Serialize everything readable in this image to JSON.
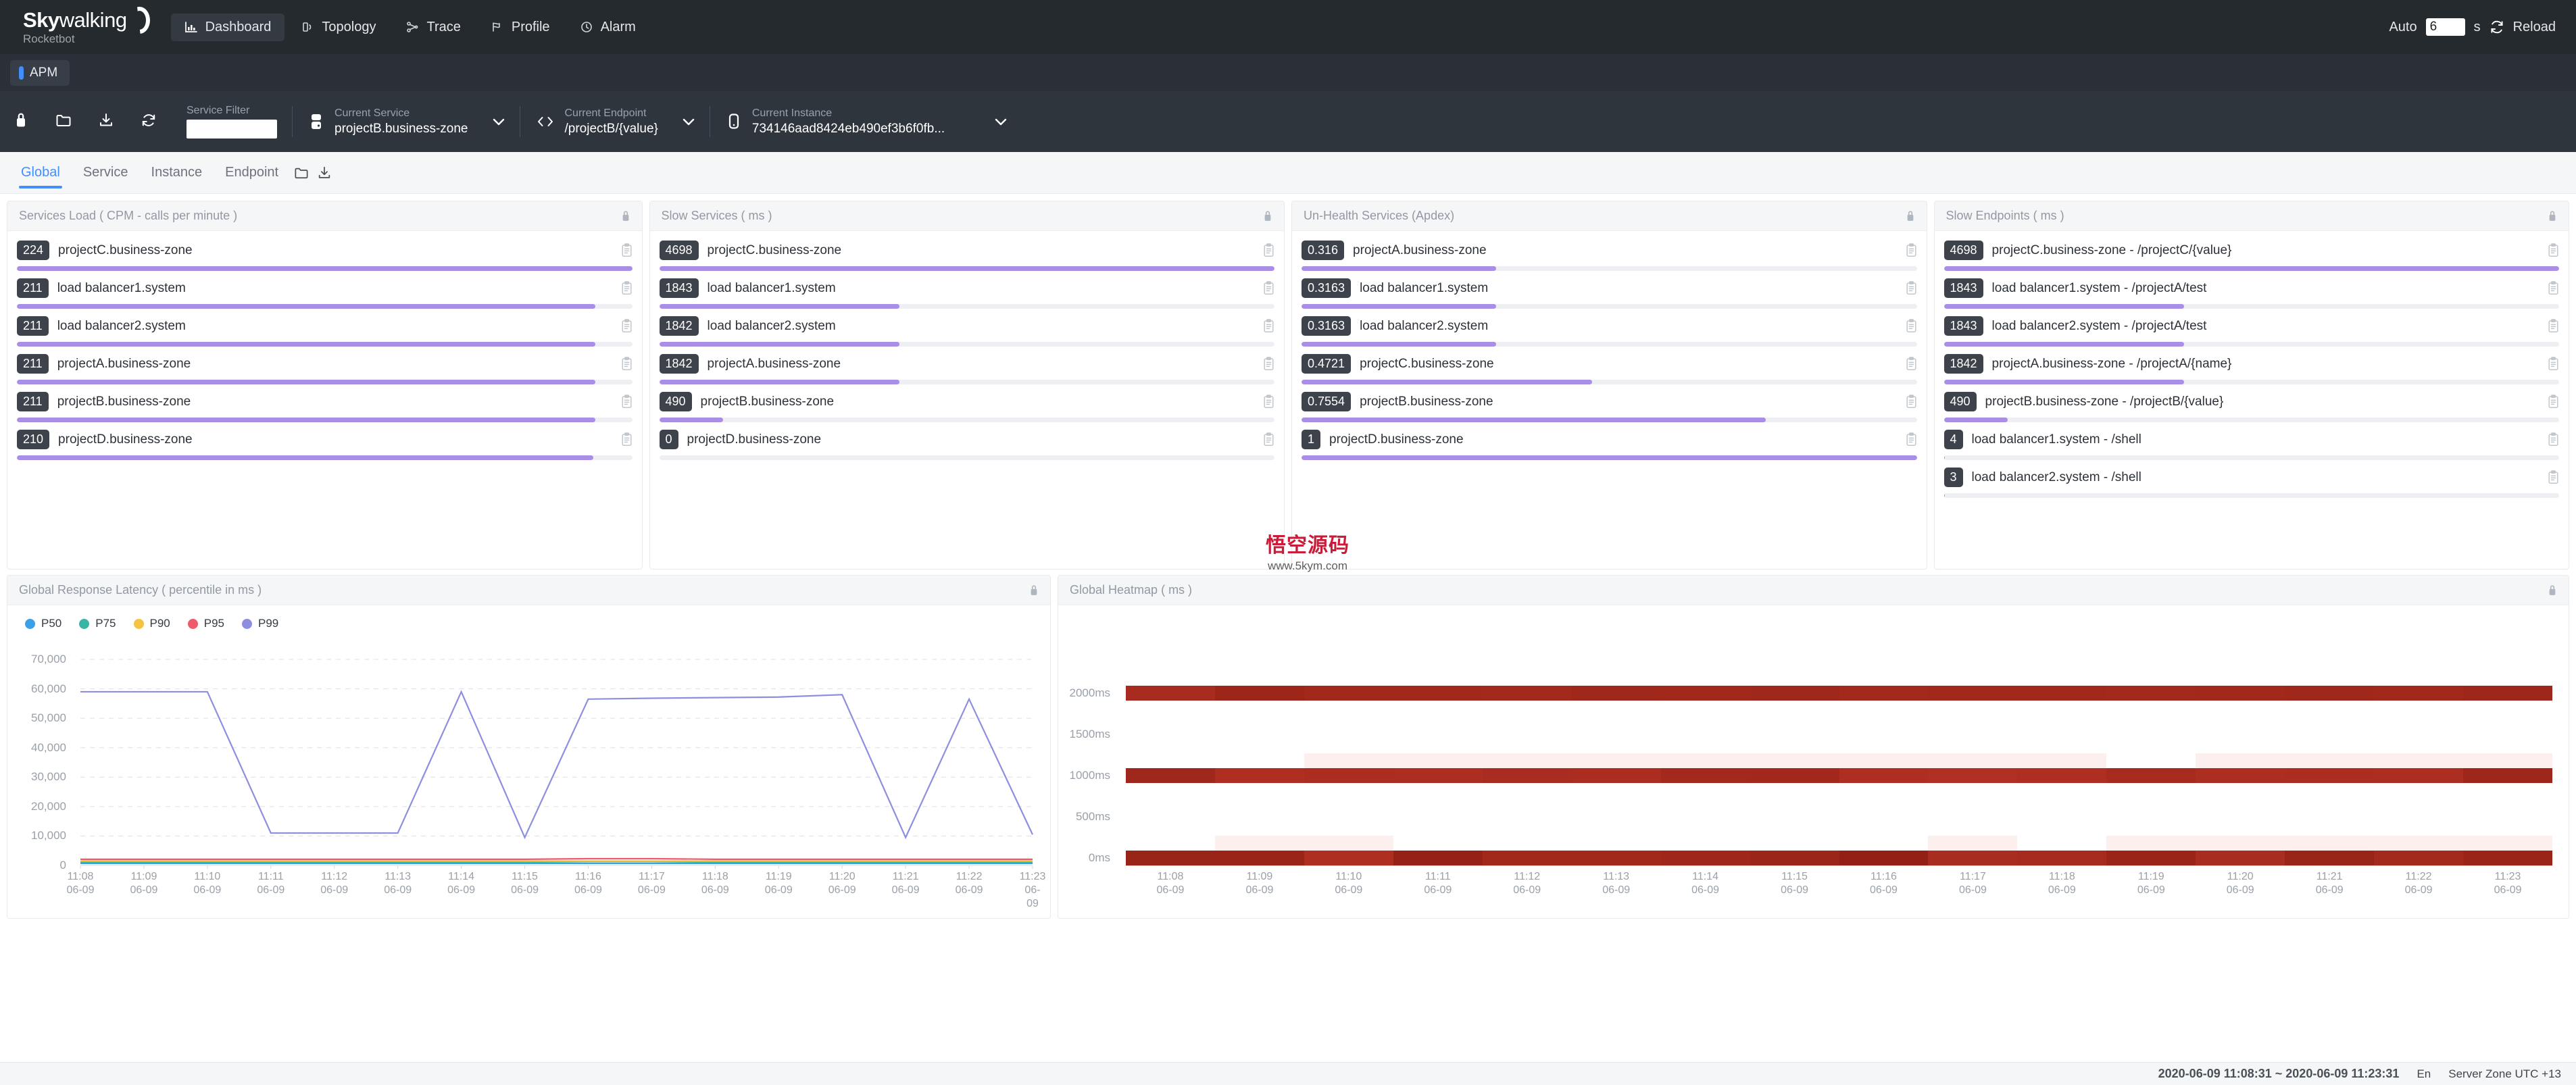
{
  "header": {
    "brand_primary": "Sky",
    "brand_secondary": "walking",
    "brand_sub": "Rocketbot",
    "nav": [
      {
        "label": "Dashboard",
        "icon": "chart-bar-icon",
        "active": true
      },
      {
        "label": "Topology",
        "icon": "topology-icon",
        "active": false
      },
      {
        "label": "Trace",
        "icon": "trace-icon",
        "active": false
      },
      {
        "label": "Profile",
        "icon": "profile-icon",
        "active": false
      },
      {
        "label": "Alarm",
        "icon": "alarm-icon",
        "active": false
      }
    ],
    "auto_label": "Auto",
    "auto_value": "6",
    "auto_unit": "s",
    "reload_label": "Reload",
    "reload_icon": "reload-icon"
  },
  "apm_bar": {
    "tab_label": "APM",
    "accent": "#448dfe"
  },
  "toolbar": {
    "icons": [
      "lock-icon",
      "folder-icon",
      "download-icon",
      "refresh-icon"
    ],
    "service_filter": {
      "label": "Service Filter",
      "value": "",
      "placeholder": ""
    },
    "current_service": {
      "label": "Current Service",
      "value": "projectB.business-zone",
      "icon": "server-icon"
    },
    "current_endpoint": {
      "label": "Current Endpoint",
      "value": "/projectB/{value}",
      "icon": "code-icon"
    },
    "current_instance": {
      "label": "Current Instance",
      "value": "734146aad8424eb490ef3b6f0fb...",
      "icon": "instance-icon"
    }
  },
  "subtabs": {
    "items": [
      {
        "label": "Global",
        "active": true
      },
      {
        "label": "Service",
        "active": false
      },
      {
        "label": "Instance",
        "active": false
      },
      {
        "label": "Endpoint",
        "active": false
      }
    ],
    "actions": [
      "folder-icon",
      "download-icon"
    ]
  },
  "cards": [
    {
      "title": "Services Load ( CPM - calls per minute )",
      "lock_icon": "lock-icon",
      "rows": [
        {
          "value": "224",
          "label": "projectC.business-zone",
          "pct": 100
        },
        {
          "value": "211",
          "label": "load balancer1.system",
          "pct": 94
        },
        {
          "value": "211",
          "label": "load balancer2.system",
          "pct": 94
        },
        {
          "value": "211",
          "label": "projectA.business-zone",
          "pct": 94
        },
        {
          "value": "211",
          "label": "projectB.business-zone",
          "pct": 94
        },
        {
          "value": "210",
          "label": "projectD.business-zone",
          "pct": 93.7
        }
      ]
    },
    {
      "title": "Slow Services ( ms )",
      "lock_icon": "lock-icon",
      "rows": [
        {
          "value": "4698",
          "label": "projectC.business-zone",
          "pct": 100
        },
        {
          "value": "1843",
          "label": "load balancer1.system",
          "pct": 39
        },
        {
          "value": "1842",
          "label": "load balancer2.system",
          "pct": 39
        },
        {
          "value": "1842",
          "label": "projectA.business-zone",
          "pct": 39
        },
        {
          "value": "490",
          "label": "projectB.business-zone",
          "pct": 10.4
        },
        {
          "value": "0",
          "label": "projectD.business-zone",
          "pct": 0
        }
      ]
    },
    {
      "title": "Un-Health Services (Apdex)",
      "lock_icon": "lock-icon",
      "rows": [
        {
          "value": "0.316",
          "label": "projectA.business-zone",
          "pct": 31.6
        },
        {
          "value": "0.3163",
          "label": "load balancer1.system",
          "pct": 31.6
        },
        {
          "value": "0.3163",
          "label": "load balancer2.system",
          "pct": 31.6
        },
        {
          "value": "0.4721",
          "label": "projectC.business-zone",
          "pct": 47.2
        },
        {
          "value": "0.7554",
          "label": "projectB.business-zone",
          "pct": 75.5
        },
        {
          "value": "1",
          "label": "projectD.business-zone",
          "pct": 100
        }
      ]
    },
    {
      "title": "Slow Endpoints ( ms )",
      "lock_icon": "lock-icon",
      "rows": [
        {
          "value": "4698",
          "label": "projectC.business-zone - /projectC/{value}",
          "pct": 100
        },
        {
          "value": "1843",
          "label": "load balancer1.system - /projectA/test",
          "pct": 39
        },
        {
          "value": "1843",
          "label": "load balancer2.system - /projectA/test",
          "pct": 39
        },
        {
          "value": "1842",
          "label": "projectA.business-zone - /projectA/{name}",
          "pct": 39
        },
        {
          "value": "490",
          "label": "projectB.business-zone - /projectB/{value}",
          "pct": 10.4
        },
        {
          "value": "4",
          "label": "load balancer1.system - /shell",
          "pct": 0.1
        },
        {
          "value": "3",
          "label": "load balancer2.system - /shell",
          "pct": 0.1
        }
      ]
    }
  ],
  "latency_card": {
    "title": "Global Response Latency ( percentile in ms )",
    "lock_icon": "lock-icon"
  },
  "heatmap_card": {
    "title": "Global Heatmap ( ms )",
    "lock_icon": "lock-icon"
  },
  "status": {
    "time_range": "2020-06-09 11:08:31 ~ 2020-06-09 11:23:31",
    "language": "En",
    "zone": "Server Zone UTC +13"
  },
  "watermark": {
    "text": "悟空源码",
    "sub": "www.5kym.com"
  },
  "chart_data": [
    {
      "type": "line",
      "title": "Global Response Latency ( percentile in ms )",
      "xlabel": "",
      "ylabel": "",
      "ylim": [
        0,
        70000
      ],
      "yticks": [
        0,
        10000,
        20000,
        30000,
        40000,
        50000,
        60000,
        70000
      ],
      "ytick_labels": [
        "0",
        "10,000",
        "20,000",
        "30,000",
        "40,000",
        "50,000",
        "60,000",
        "70,000"
      ],
      "grid": true,
      "legend_position": "top-left",
      "x": [
        "11:08\n06-09",
        "11:09\n06-09",
        "11:10\n06-09",
        "11:11\n06-09",
        "11:12\n06-09",
        "11:13\n06-09",
        "11:14\n06-09",
        "11:15\n06-09",
        "11:16\n06-09",
        "11:17\n06-09",
        "11:18\n06-09",
        "11:19\n06-09",
        "11:20\n06-09",
        "11:21\n06-09",
        "11:22\n06-09",
        "11:23\n06-09"
      ],
      "series": [
        {
          "name": "P50",
          "color": "#3aa0e8",
          "values": [
            700,
            700,
            700,
            700,
            700,
            700,
            700,
            700,
            700,
            700,
            700,
            700,
            700,
            700,
            700,
            700
          ]
        },
        {
          "name": "P75",
          "color": "#37b6a8",
          "values": [
            1100,
            1100,
            1100,
            1100,
            1100,
            1100,
            1100,
            1100,
            1300,
            1300,
            1100,
            1100,
            1100,
            1100,
            1100,
            1100
          ]
        },
        {
          "name": "P90",
          "color": "#f5c242",
          "values": [
            1500,
            1500,
            1500,
            1500,
            1500,
            1500,
            1500,
            1500,
            1500,
            1500,
            1500,
            1500,
            1500,
            1500,
            1500,
            1500
          ]
        },
        {
          "name": "P95",
          "color": "#ef5a6a",
          "values": [
            2100,
            2100,
            2100,
            2100,
            2100,
            2100,
            2100,
            2100,
            2300,
            2300,
            2100,
            2100,
            2100,
            2100,
            2100,
            2100
          ]
        },
        {
          "name": "P99",
          "color": "#8e8ee0",
          "values": [
            59000,
            59000,
            59000,
            11000,
            11000,
            11000,
            59000,
            9500,
            56500,
            56800,
            57000,
            57200,
            58000,
            9500,
            56500,
            10500
          ]
        }
      ]
    },
    {
      "type": "heatmap",
      "title": "Global Heatmap ( ms )",
      "ylabel": "",
      "yticks": [
        0,
        500,
        1000,
        1500,
        2000
      ],
      "ytick_labels": [
        "0ms",
        "500ms",
        "1000ms",
        "1500ms",
        "2000ms"
      ],
      "x": [
        "11:08\n06-09",
        "11:09\n06-09",
        "11:10\n06-09",
        "11:11\n06-09",
        "11:12\n06-09",
        "11:13\n06-09",
        "11:14\n06-09",
        "11:15\n06-09",
        "11:16\n06-09",
        "11:17\n06-09",
        "11:18\n06-09",
        "11:19\n06-09",
        "11:20\n06-09",
        "11:21\n06-09",
        "11:22\n06-09",
        "11:23\n06-09"
      ],
      "rows": [
        "2000ms",
        "1500ms",
        "1000ms",
        "500ms",
        "0ms"
      ],
      "colorscale": [
        "#fdf0ef",
        "#c0392b",
        "#8e1d12"
      ],
      "values": [
        [
          0.75,
          0.85,
          0.8,
          0.8,
          0.78,
          0.82,
          0.8,
          0.83,
          0.79,
          0.8,
          0.81,
          0.78,
          0.8,
          0.82,
          0.8,
          0.84
        ],
        [
          0,
          0,
          0,
          0,
          0,
          0,
          0,
          0,
          0,
          0,
          0,
          0,
          0,
          0,
          0,
          0
        ],
        [
          0.82,
          0.68,
          0.72,
          0.7,
          0.74,
          0.72,
          0.78,
          0.8,
          0.68,
          0.66,
          0.68,
          0.76,
          0.7,
          0.72,
          0.7,
          0.84
        ],
        [
          0,
          0,
          0,
          0,
          0,
          0,
          0,
          0,
          0,
          0,
          0,
          0,
          0,
          0,
          0,
          0
        ],
        [
          0.9,
          0.88,
          0.68,
          0.92,
          0.8,
          0.8,
          0.84,
          0.86,
          0.95,
          0.74,
          0.76,
          0.88,
          0.74,
          0.9,
          0.78,
          0.88
        ]
      ]
    }
  ]
}
